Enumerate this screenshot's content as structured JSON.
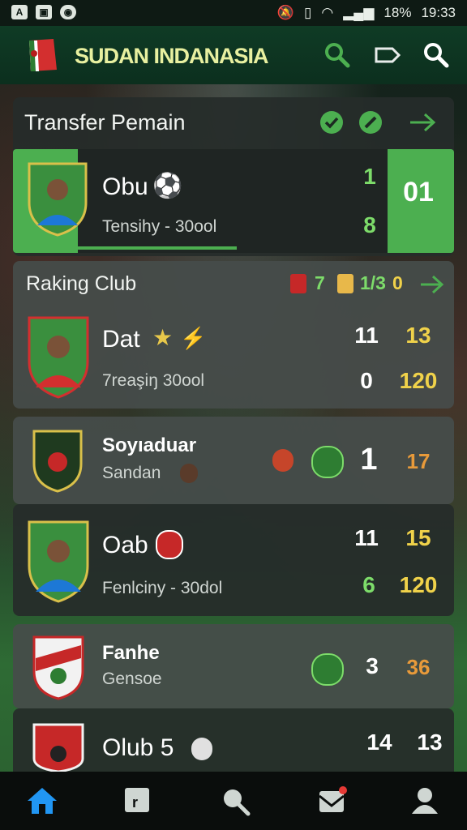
{
  "status_bar": {
    "battery": "18%",
    "time": "19:33"
  },
  "app": {
    "title": "SUDAN INDANASIA"
  },
  "transfer": {
    "title": "Transfer Pemain",
    "player": {
      "name": "Obu",
      "subtitle": "Tensihy - 30ool",
      "top_value": "1",
      "bottom_value": "8",
      "highlight_value": "01"
    }
  },
  "ranking": {
    "title": "Raking Club",
    "header_values": [
      "7",
      "1/3",
      "0"
    ],
    "rows": [
      {
        "name": "Dat",
        "subtitle": "7reaşiŋ   30ool",
        "v1": "11",
        "v2": "13",
        "v3": "0",
        "v4": "120"
      },
      {
        "name": "Soyıaduar",
        "subtitle": "Sandan",
        "v1": "1",
        "v2": "17"
      },
      {
        "name": "Oab",
        "subtitle": "Fenlciny - 30dol",
        "v1": "11",
        "v2": "15",
        "v3": "6",
        "v4": "120"
      },
      {
        "name": "Fanhe",
        "subtitle": "Gensoe",
        "v1": "3",
        "v2": "36"
      },
      {
        "name": "Olub  5",
        "v1": "14",
        "v2": "13"
      }
    ]
  },
  "colors": {
    "accent_green": "#4caf50",
    "appbar": "#0f3b25",
    "yellow": "#f0d24a"
  }
}
